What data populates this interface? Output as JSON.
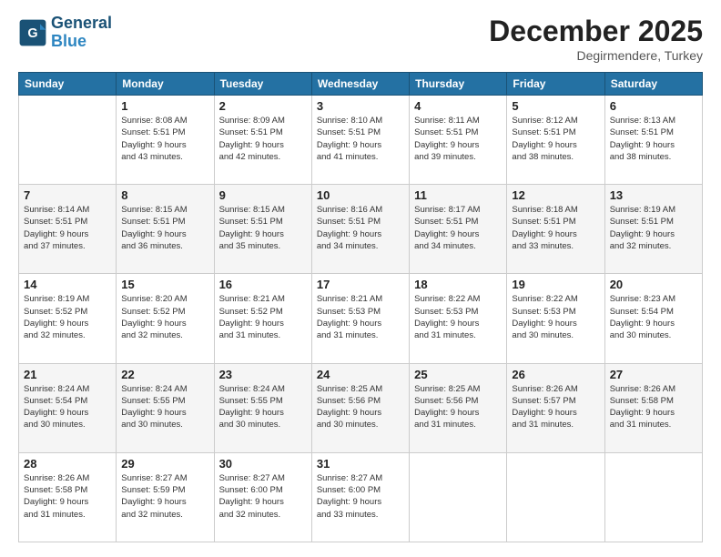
{
  "header": {
    "logo_line1": "General",
    "logo_line2": "Blue",
    "month": "December 2025",
    "location": "Degirmendere, Turkey"
  },
  "days_of_week": [
    "Sunday",
    "Monday",
    "Tuesday",
    "Wednesday",
    "Thursday",
    "Friday",
    "Saturday"
  ],
  "weeks": [
    [
      {
        "day": "",
        "info": ""
      },
      {
        "day": "1",
        "info": "Sunrise: 8:08 AM\nSunset: 5:51 PM\nDaylight: 9 hours\nand 43 minutes."
      },
      {
        "day": "2",
        "info": "Sunrise: 8:09 AM\nSunset: 5:51 PM\nDaylight: 9 hours\nand 42 minutes."
      },
      {
        "day": "3",
        "info": "Sunrise: 8:10 AM\nSunset: 5:51 PM\nDaylight: 9 hours\nand 41 minutes."
      },
      {
        "day": "4",
        "info": "Sunrise: 8:11 AM\nSunset: 5:51 PM\nDaylight: 9 hours\nand 39 minutes."
      },
      {
        "day": "5",
        "info": "Sunrise: 8:12 AM\nSunset: 5:51 PM\nDaylight: 9 hours\nand 38 minutes."
      },
      {
        "day": "6",
        "info": "Sunrise: 8:13 AM\nSunset: 5:51 PM\nDaylight: 9 hours\nand 38 minutes."
      }
    ],
    [
      {
        "day": "7",
        "info": "Sunrise: 8:14 AM\nSunset: 5:51 PM\nDaylight: 9 hours\nand 37 minutes."
      },
      {
        "day": "8",
        "info": "Sunrise: 8:15 AM\nSunset: 5:51 PM\nDaylight: 9 hours\nand 36 minutes."
      },
      {
        "day": "9",
        "info": "Sunrise: 8:15 AM\nSunset: 5:51 PM\nDaylight: 9 hours\nand 35 minutes."
      },
      {
        "day": "10",
        "info": "Sunrise: 8:16 AM\nSunset: 5:51 PM\nDaylight: 9 hours\nand 34 minutes."
      },
      {
        "day": "11",
        "info": "Sunrise: 8:17 AM\nSunset: 5:51 PM\nDaylight: 9 hours\nand 34 minutes."
      },
      {
        "day": "12",
        "info": "Sunrise: 8:18 AM\nSunset: 5:51 PM\nDaylight: 9 hours\nand 33 minutes."
      },
      {
        "day": "13",
        "info": "Sunrise: 8:19 AM\nSunset: 5:51 PM\nDaylight: 9 hours\nand 32 minutes."
      }
    ],
    [
      {
        "day": "14",
        "info": "Sunrise: 8:19 AM\nSunset: 5:52 PM\nDaylight: 9 hours\nand 32 minutes."
      },
      {
        "day": "15",
        "info": "Sunrise: 8:20 AM\nSunset: 5:52 PM\nDaylight: 9 hours\nand 32 minutes."
      },
      {
        "day": "16",
        "info": "Sunrise: 8:21 AM\nSunset: 5:52 PM\nDaylight: 9 hours\nand 31 minutes."
      },
      {
        "day": "17",
        "info": "Sunrise: 8:21 AM\nSunset: 5:53 PM\nDaylight: 9 hours\nand 31 minutes."
      },
      {
        "day": "18",
        "info": "Sunrise: 8:22 AM\nSunset: 5:53 PM\nDaylight: 9 hours\nand 31 minutes."
      },
      {
        "day": "19",
        "info": "Sunrise: 8:22 AM\nSunset: 5:53 PM\nDaylight: 9 hours\nand 30 minutes."
      },
      {
        "day": "20",
        "info": "Sunrise: 8:23 AM\nSunset: 5:54 PM\nDaylight: 9 hours\nand 30 minutes."
      }
    ],
    [
      {
        "day": "21",
        "info": "Sunrise: 8:24 AM\nSunset: 5:54 PM\nDaylight: 9 hours\nand 30 minutes."
      },
      {
        "day": "22",
        "info": "Sunrise: 8:24 AM\nSunset: 5:55 PM\nDaylight: 9 hours\nand 30 minutes."
      },
      {
        "day": "23",
        "info": "Sunrise: 8:24 AM\nSunset: 5:55 PM\nDaylight: 9 hours\nand 30 minutes."
      },
      {
        "day": "24",
        "info": "Sunrise: 8:25 AM\nSunset: 5:56 PM\nDaylight: 9 hours\nand 30 minutes."
      },
      {
        "day": "25",
        "info": "Sunrise: 8:25 AM\nSunset: 5:56 PM\nDaylight: 9 hours\nand 31 minutes."
      },
      {
        "day": "26",
        "info": "Sunrise: 8:26 AM\nSunset: 5:57 PM\nDaylight: 9 hours\nand 31 minutes."
      },
      {
        "day": "27",
        "info": "Sunrise: 8:26 AM\nSunset: 5:58 PM\nDaylight: 9 hours\nand 31 minutes."
      }
    ],
    [
      {
        "day": "28",
        "info": "Sunrise: 8:26 AM\nSunset: 5:58 PM\nDaylight: 9 hours\nand 31 minutes."
      },
      {
        "day": "29",
        "info": "Sunrise: 8:27 AM\nSunset: 5:59 PM\nDaylight: 9 hours\nand 32 minutes."
      },
      {
        "day": "30",
        "info": "Sunrise: 8:27 AM\nSunset: 6:00 PM\nDaylight: 9 hours\nand 32 minutes."
      },
      {
        "day": "31",
        "info": "Sunrise: 8:27 AM\nSunset: 6:00 PM\nDaylight: 9 hours\nand 33 minutes."
      },
      {
        "day": "",
        "info": ""
      },
      {
        "day": "",
        "info": ""
      },
      {
        "day": "",
        "info": ""
      }
    ]
  ]
}
